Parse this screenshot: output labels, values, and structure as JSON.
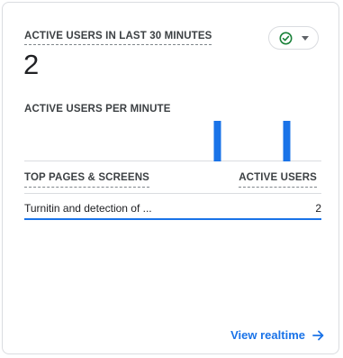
{
  "card": {
    "metric_label": "ACTIVE USERS IN LAST 30 MINUTES",
    "metric_value": "2",
    "status_icon": "check-circle-icon",
    "status_dropdown_icon": "caret-down-icon"
  },
  "chart_data": {
    "type": "bar",
    "title": "ACTIVE USERS PER MINUTE",
    "x": [
      1,
      2,
      3,
      4,
      5,
      6,
      7,
      8,
      9,
      10,
      11,
      12,
      13,
      14,
      15,
      16,
      17,
      18,
      19,
      20,
      21,
      22,
      23,
      24,
      25,
      26,
      27,
      28,
      29,
      30
    ],
    "values": [
      0,
      0,
      0,
      0,
      0,
      0,
      0,
      0,
      0,
      0,
      0,
      0,
      0,
      0,
      0,
      0,
      0,
      0,
      0,
      1,
      0,
      0,
      0,
      0,
      0,
      0,
      1,
      0,
      0,
      0
    ],
    "ylim": [
      0,
      1
    ],
    "bar_color": "#1a73e8",
    "baseline_color": "#dadce0"
  },
  "table": {
    "header_left": "TOP PAGES & SCREENS",
    "header_right": "ACTIVE USERS",
    "rows": [
      {
        "page": "Turnitin and detection of ...",
        "users": "2"
      }
    ]
  },
  "footer": {
    "link_label": "View realtime",
    "link_icon": "arrow-right-icon"
  },
  "colors": {
    "accent": "#1a73e8",
    "status_green": "#188038"
  }
}
